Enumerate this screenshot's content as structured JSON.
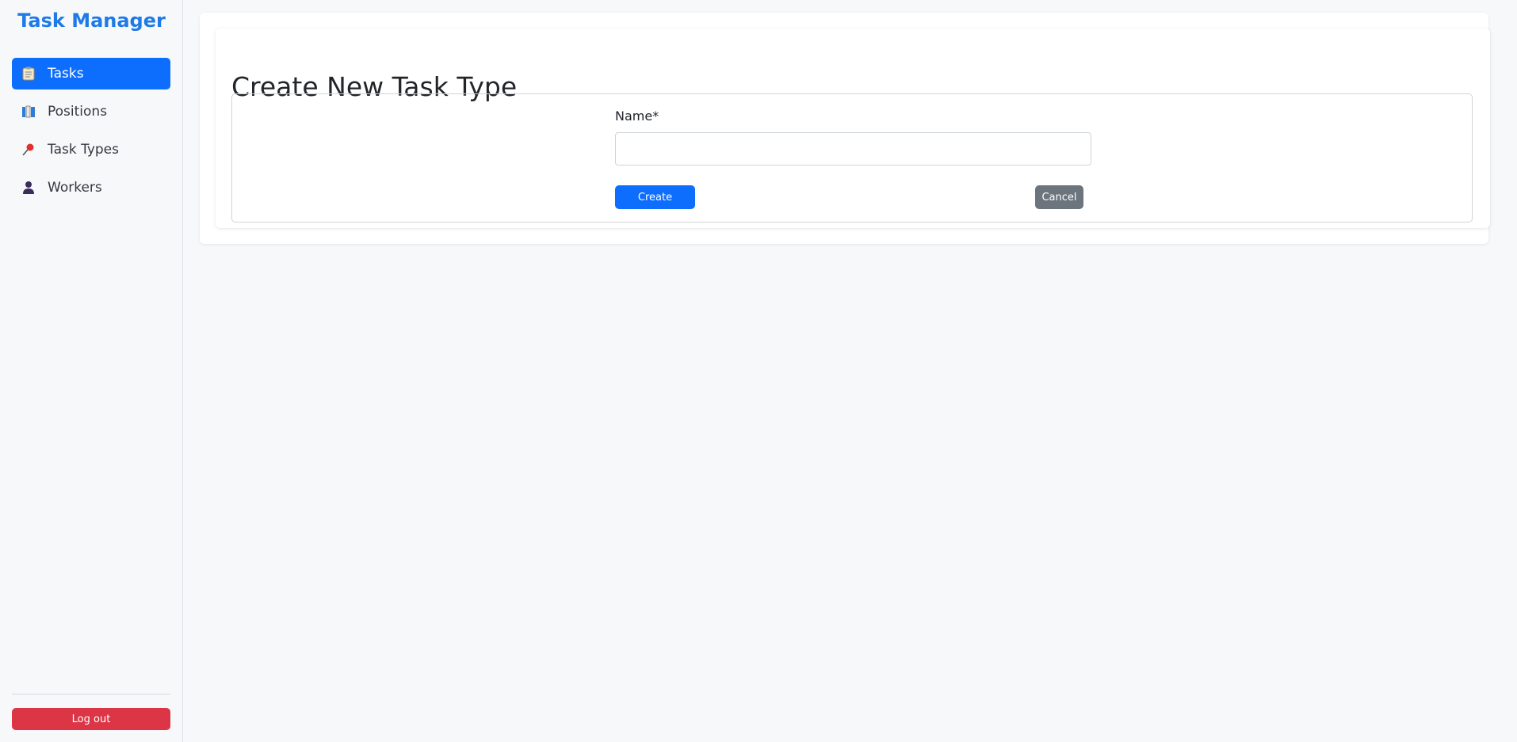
{
  "app": {
    "title": "Task Manager"
  },
  "sidebar": {
    "items": [
      {
        "label": "Tasks",
        "icon": "clipboard-icon",
        "active": true
      },
      {
        "label": "Positions",
        "icon": "books-icon",
        "active": false
      },
      {
        "label": "Task Types",
        "icon": "pushpin-icon",
        "active": false
      },
      {
        "label": "Workers",
        "icon": "person-icon",
        "active": false
      }
    ],
    "logout_label": "Log out"
  },
  "main": {
    "title": "Create New Task Type",
    "form": {
      "name_label": "Name*",
      "name_value": "",
      "name_placeholder": "",
      "create_label": "Create",
      "cancel_label": "Cancel"
    }
  },
  "colors": {
    "accent": "#0d6efd",
    "brand": "#1d7ae6",
    "danger": "#dc3545",
    "secondary": "#6c757d"
  }
}
